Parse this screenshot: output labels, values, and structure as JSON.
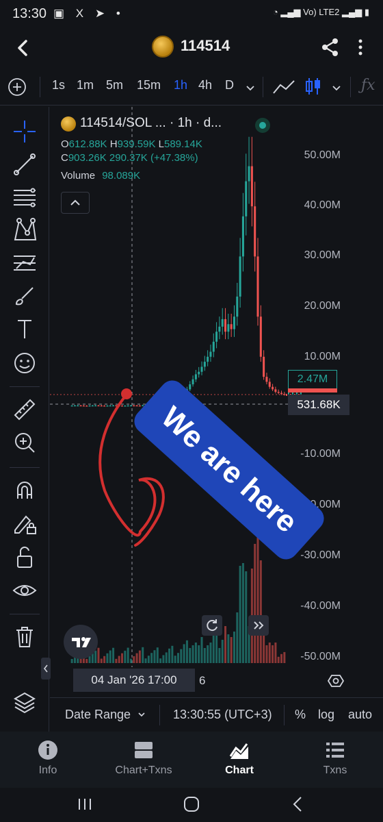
{
  "status_bar": {
    "time": "13:30",
    "network": "Vo) LTE2"
  },
  "header": {
    "title": "114514"
  },
  "toolbar": {
    "intervals": [
      "1s",
      "1m",
      "5m",
      "15m",
      "1h",
      "4h",
      "D"
    ],
    "active_interval": "1h"
  },
  "legend": {
    "symbol": "114514/SOL ... · 1h · d...",
    "open_label": "O",
    "open": "612.88K",
    "high_label": "H",
    "high": "939.59K",
    "low_label": "L",
    "low": "589.14K",
    "close_label": "C",
    "close": "903.26K",
    "change": "290.37K (+47.38%)",
    "volume_label": "Volume",
    "volume": "98.089K"
  },
  "price_axis": [
    "50.00M",
    "40.00M",
    "30.00M",
    "20.00M",
    "10.00M",
    "-10.00M",
    "-20.00M",
    "-30.00M",
    "-40.00M",
    "-50.00M"
  ],
  "current_tag": "2.47M",
  "crosshair_price": "531.68K",
  "annotation": {
    "text": "We are here"
  },
  "time_axis": {
    "date_label": "04 Jan '26   17:00",
    "next_label": "6"
  },
  "date_bar": {
    "range": "Date Range",
    "clock": "13:30:55 (UTC+3)",
    "percent": "%",
    "log": "log",
    "auto": "auto"
  },
  "tabs": [
    {
      "label": "Info",
      "icon": "info-icon"
    },
    {
      "label": "Chart+Txns",
      "icon": "split-view-icon"
    },
    {
      "label": "Chart",
      "icon": "chart-icon"
    },
    {
      "label": "Txns",
      "icon": "list-icon"
    }
  ],
  "active_tab": "Chart",
  "colors": {
    "up": "#26a69a",
    "down": "#ef5350",
    "accent": "#2962ff",
    "annotation": "#1f46b8",
    "marker": "#d32f2f"
  },
  "chart_data": {
    "type": "candlestick",
    "pair": "114514/SOL",
    "interval": "1h",
    "ylim": [
      -50000000,
      50000000
    ],
    "close_series": [
      0.3,
      0.35,
      0.4,
      0.45,
      0.5,
      0.55,
      0.6,
      0.7,
      0.8,
      1.0,
      1.2,
      1.5,
      1.8,
      2.2,
      2.8,
      3.5,
      4.5,
      5.5,
      6.5,
      7.0,
      8.0,
      9.0,
      10.0,
      11.0,
      13.0,
      15.0,
      16.0,
      17.5,
      15.0,
      16.5,
      15.5,
      18.0,
      22.0,
      30.0,
      38.0,
      45.0,
      48.0,
      40.0,
      30.0,
      18.0,
      10.0,
      6.0,
      5.0,
      4.0,
      3.5,
      3.0,
      2.8,
      2.6,
      2.47
    ]
  }
}
